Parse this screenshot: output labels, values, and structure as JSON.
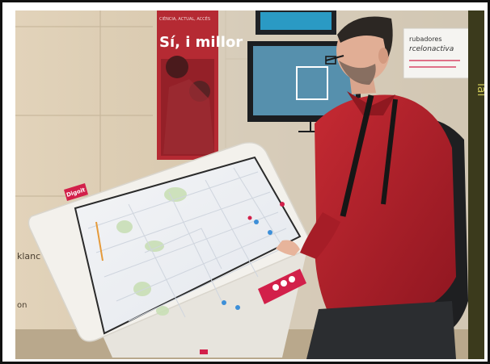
{
  "poster": {
    "headline": "Sí, i millor",
    "kicker": "CIÈNCIA, ACTUAL, ACCÉS"
  },
  "kiosk": {
    "brand": "Digoit",
    "accent": "#d2204a",
    "frame_color": "#f1efea"
  },
  "sign": {
    "line1": "rubadores",
    "line2": "rcelonactiva"
  },
  "wall_fragments": {
    "left_upper": "klanc",
    "left_lower": "on",
    "right_edge": "ial"
  },
  "colors": {
    "shirt": "#b41f2a",
    "wall": "#d6c6ad",
    "map_bg": "#eef1f4",
    "map_park": "#c9dfb6"
  }
}
